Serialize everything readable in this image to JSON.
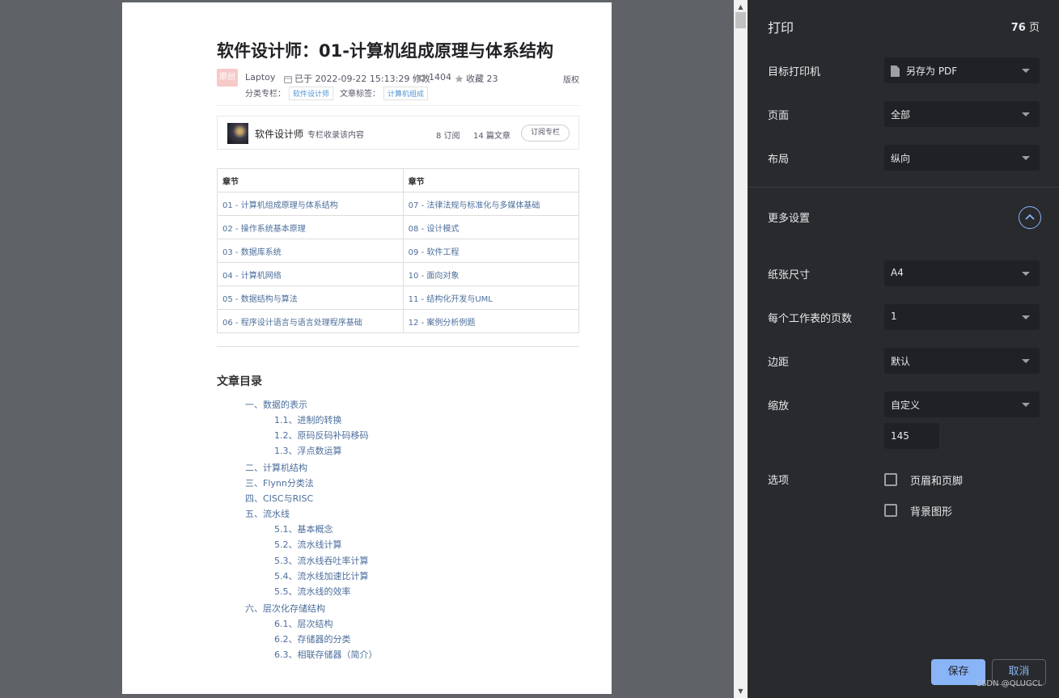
{
  "article": {
    "title": "软件设计师：01-计算机组成原理与体系结构",
    "badge": "原创",
    "author": "Laptoy",
    "date": "已于 2022-09-22 15:13:29 修改",
    "views": "1404",
    "favorites": "收藏 23",
    "copyright": "版权",
    "column_label": "分类专栏：",
    "column_tag": "软件设计师",
    "article_tag_label": "文章标签：",
    "article_tag": "计算机组成"
  },
  "column_box": {
    "name": "软件设计师",
    "desc": "专栏收录该内容",
    "subscriptions": "8 订阅",
    "articles": "14 篇文章",
    "subscribe_button": "订阅专栏"
  },
  "chapters": {
    "headers": [
      "章节",
      "章节"
    ],
    "rows": [
      [
        "01 - 计算机组成原理与体系结构",
        "07 - 法律法规与标准化与多媒体基础"
      ],
      [
        "02 - 操作系统基本原理",
        "08 - 设计模式"
      ],
      [
        "03 - 数据库系统",
        "09 - 软件工程"
      ],
      [
        "04 - 计算机网络",
        "10 - 面向对象"
      ],
      [
        "05 - 数据结构与算法",
        "11 - 结构化开发与UML"
      ],
      [
        "06 - 程序设计语言与语言处理程序基础",
        "12 - 案例分析例题"
      ]
    ]
  },
  "toc": {
    "title": "文章目录",
    "items": [
      {
        "text": "一、数据的表示",
        "level": 1
      },
      {
        "text": "1.1、进制的转换",
        "level": 2
      },
      {
        "text": "1.2、原码反码补码移码",
        "level": 2
      },
      {
        "text": "1.3、浮点数运算",
        "level": 2
      },
      {
        "text": "二、计算机结构",
        "level": 1
      },
      {
        "text": "三、Flynn分类法",
        "level": 1
      },
      {
        "text": "四、CISC与RISC",
        "level": 1
      },
      {
        "text": "五、流水线",
        "level": 1
      },
      {
        "text": "5.1、基本概念",
        "level": 2
      },
      {
        "text": "5.2、流水线计算",
        "level": 2
      },
      {
        "text": "5.3、流水线吞吐率计算",
        "level": 2
      },
      {
        "text": "5.4、流水线加速比计算",
        "level": 2
      },
      {
        "text": "5.5、流水线的效率",
        "level": 2
      },
      {
        "text": "六、层次化存储结构",
        "level": 1
      },
      {
        "text": "6.1、层次结构",
        "level": 2
      },
      {
        "text": "6.2、存储器的分类",
        "level": 2
      },
      {
        "text": "6.3、相联存储器（简介）",
        "level": 2
      }
    ]
  },
  "print_panel": {
    "title": "打印",
    "page_count": "76",
    "page_unit": " 页",
    "destination_label": "目标打印机",
    "destination_value": "另存为 PDF",
    "pages_label": "页面",
    "pages_value": "全部",
    "layout_label": "布局",
    "layout_value": "纵向",
    "more_settings_label": "更多设置",
    "paper_size_label": "纸张尺寸",
    "paper_size_value": "A4",
    "pages_per_sheet_label": "每个工作表的页数",
    "pages_per_sheet_value": "1",
    "margins_label": "边距",
    "margins_value": "默认",
    "scale_label": "缩放",
    "scale_value": "自定义",
    "scale_input": "145",
    "options_label": "选项",
    "option_header_footer": "页眉和页脚",
    "option_background": "背景图形",
    "save_button": "保存",
    "cancel_button": "取消",
    "watermark": "CSDN @QLUGCL"
  },
  "colors": {
    "panel_bg": "#292a2d",
    "select_bg": "#202124",
    "accent": "#8ab4f8",
    "link": "#4c6e9b"
  }
}
